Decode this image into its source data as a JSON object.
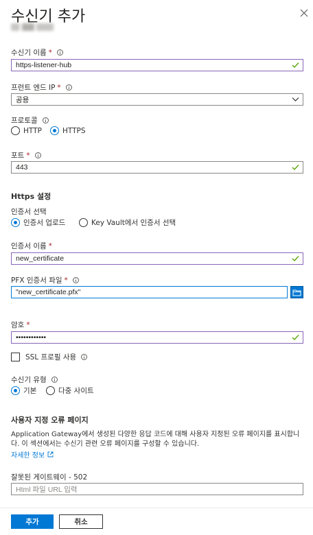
{
  "header": {
    "title": "수신기 추가",
    "close_icon": "close-icon"
  },
  "listener_name": {
    "label": "수신기 이름",
    "value": "https-listener-hub"
  },
  "frontend_ip": {
    "label": "프런트 엔드 IP",
    "value": "공용"
  },
  "protocol": {
    "label": "프로토콜",
    "options": [
      "HTTP",
      "HTTPS"
    ],
    "selected": "HTTPS"
  },
  "port": {
    "label": "포트",
    "value": "443"
  },
  "https_settings": {
    "title": "Https 설정",
    "cert_select_label": "인증서 선택",
    "cert_options": [
      "인증서 업로드",
      "Key Vault에서 인증서 선택"
    ],
    "cert_selected": "인증서 업로드",
    "cert_name_label": "인증서 이름",
    "cert_name_value": "new_certificate",
    "pfx_label": "PFX 인증서 파일",
    "pfx_value": "\"new_certificate.pfx\"",
    "password_label": "암호",
    "password_value": "••••••••••••",
    "ssl_profile_label": "SSL 프로필 사용"
  },
  "listener_type": {
    "label": "수신기 유형",
    "options": [
      "기본",
      "다중 사이트"
    ],
    "selected": "기본"
  },
  "custom_error": {
    "title": "사용자 지정 오류 페이지",
    "description": "Application Gateway에서 생성된 다양한 응답 코드에 대해 사용자 지정된 오류 페이지를 표시합니다. 이 섹션에서는 수신기 관련 오류 페이지를 구성할 수 있습니다.",
    "learn_more": "자세한 정보",
    "bad_gateway_label": "잘못된 게이트웨이 - 502",
    "bad_gateway_placeholder": "Html 파일 URL 입력"
  },
  "footer": {
    "add_label": "추가",
    "cancel_label": "취소"
  },
  "colors": {
    "accent": "#0078d4",
    "valid_border": "#8764b8",
    "check": "#57a300",
    "required": "#a4262c"
  }
}
